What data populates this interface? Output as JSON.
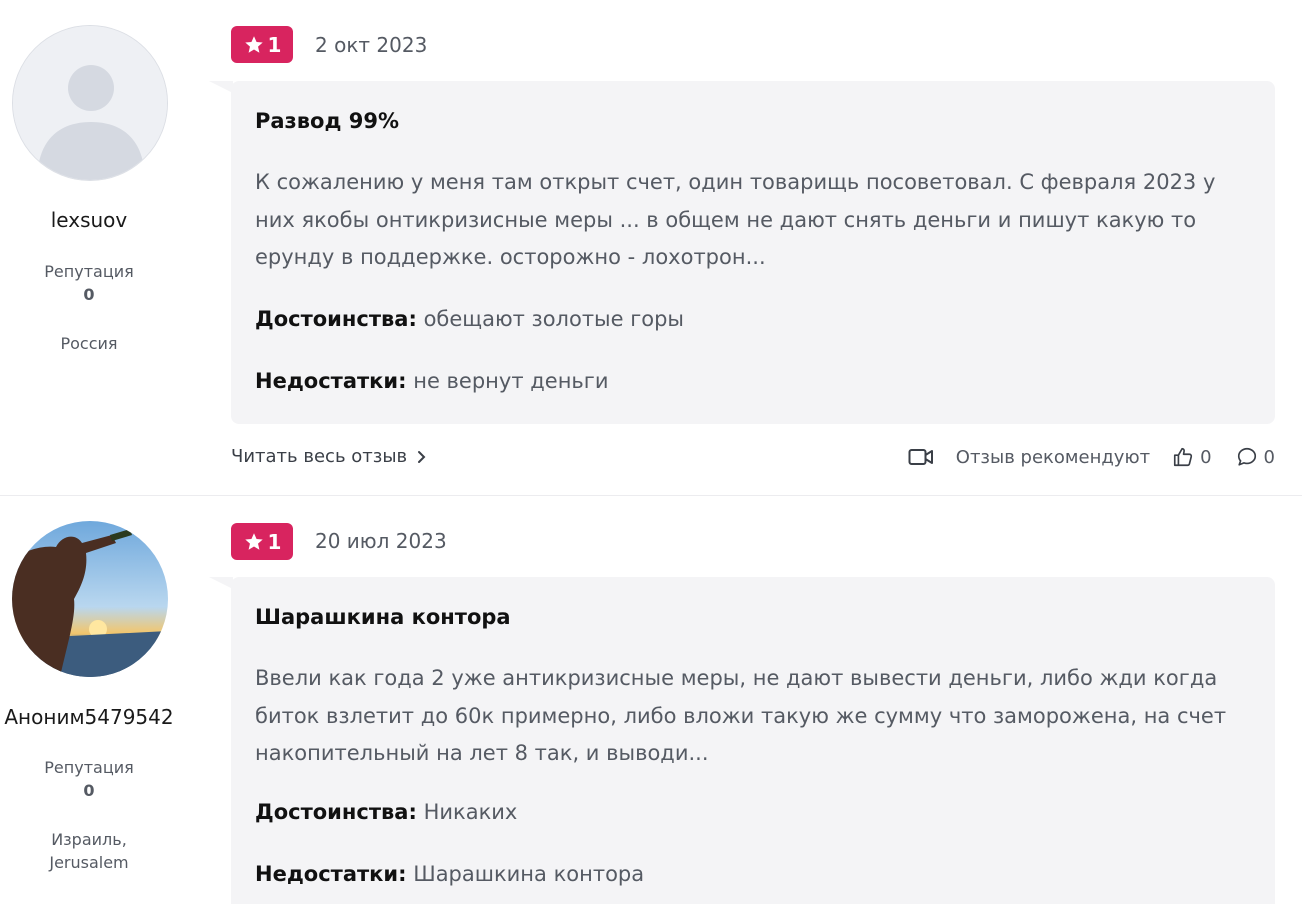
{
  "reviews": [
    {
      "author": "lexsuov",
      "reputation_label": "Репутация",
      "reputation_value": "0",
      "location": "Россия",
      "rating": "1",
      "date": "2 окт 2023",
      "title": "Развод 99%",
      "text": "К сожалению у меня там открыт счет, один товарищь посоветовал. С февраля 2023 у них якобы онтикризисные меры ... в общем не дают снять деньги и пишут какую то ерунду в поддержке. осторожно - лохотрон...",
      "pros_label": "Достоинства:",
      "pros": "обещают золотые горы",
      "cons_label": "Недостатки:",
      "cons": "не вернут деньги",
      "read_more": "Читать весь отзыв",
      "recommend_label": "Отзыв рекомендуют",
      "likes": "0",
      "comments": "0"
    },
    {
      "author": "Аноним5479542",
      "reputation_label": "Репутация",
      "reputation_value": "0",
      "location": "Израиль, Jerusalem",
      "rating": "1",
      "date": "20 июл 2023",
      "title": "Шарашкина контора",
      "text": "Ввели как года 2 уже антикризисные меры, не дают вывести деньги, либо жди когда биток взлетит до 60к примерно, либо вложи такую же сумму что заморожена, на счет накопительный на лет 8 так, и выводи...",
      "pros_label": "Достоинства:",
      "pros": "Никаких",
      "cons_label": "Недостатки:",
      "cons": "Шарашкина контора"
    }
  ],
  "colors": {
    "rating_badge": "#d8245f",
    "card_bg": "#f4f4f6",
    "muted_text": "#555a63"
  },
  "icons": [
    "default-avatar-icon",
    "star-icon",
    "chevron-right-icon",
    "video-camera-icon",
    "thumbs-up-icon",
    "comment-icon"
  ]
}
